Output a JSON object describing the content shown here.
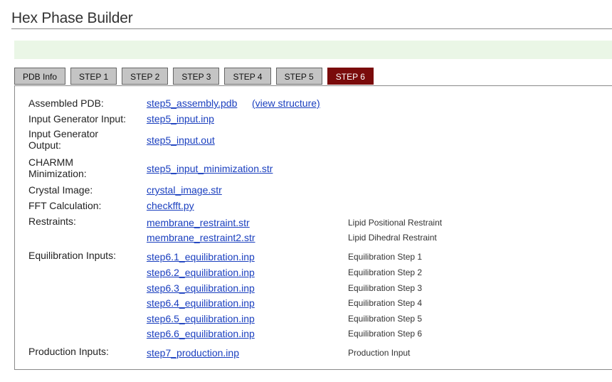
{
  "page": {
    "title": "Hex Phase Builder"
  },
  "tabs": [
    "PDB Info",
    "STEP 1",
    "STEP 2",
    "STEP 3",
    "STEP 4",
    "STEP 5",
    "STEP 6"
  ],
  "active_tab": "STEP 6",
  "rows": {
    "assembled": {
      "label": "Assembled PDB:",
      "link": "step5_assembly.pdb",
      "extra": "(view structure)"
    },
    "input_gen": {
      "label": "Input Generator Input:",
      "link": "step5_input.inp"
    },
    "input_out": {
      "label": "Input Generator Output:",
      "link": "step5_input.out"
    },
    "charmm_min": {
      "label": "CHARMM Minimization:",
      "link": "step5_input_minimization.str"
    },
    "crystal": {
      "label": "Crystal Image:",
      "link": "crystal_image.str"
    },
    "fft": {
      "label": "FFT Calculation:",
      "link": "checkfft.py"
    },
    "restraints": {
      "label": "Restraints:",
      "items": [
        {
          "link": "membrane_restraint.str",
          "desc": "Lipid Positional Restraint"
        },
        {
          "link": "membrane_restraint2.str",
          "desc": "Lipid Dihedral Restraint"
        }
      ]
    },
    "equilibration": {
      "label": "Equilibration Inputs:",
      "items": [
        {
          "link": "step6.1_equilibration.inp",
          "desc": "Equilibration Step 1"
        },
        {
          "link": "step6.2_equilibration.inp",
          "desc": "Equilibration Step 2"
        },
        {
          "link": "step6.3_equilibration.inp",
          "desc": "Equilibration Step 3"
        },
        {
          "link": "step6.4_equilibration.inp",
          "desc": "Equilibration Step 4"
        },
        {
          "link": "step6.5_equilibration.inp",
          "desc": "Equilibration Step 5"
        },
        {
          "link": "step6.6_equilibration.inp",
          "desc": "Equilibration Step 6"
        }
      ]
    },
    "production": {
      "label": "Production Inputs:",
      "link": "step7_production.inp",
      "desc": "Production Input"
    }
  },
  "colors": {
    "active_tab": "#7a0b0b",
    "link": "#1a3fbf",
    "message_bar": "#eaf6e6"
  }
}
